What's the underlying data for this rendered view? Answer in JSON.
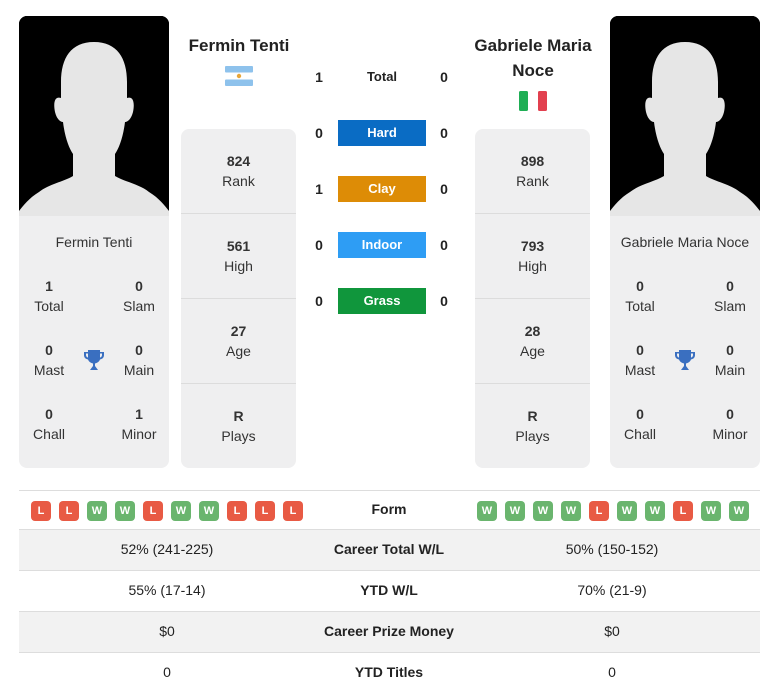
{
  "player1": {
    "name": "Fermin Tenti",
    "country_flag": "argentina-flag",
    "titles": {
      "total": {
        "value": "1",
        "label": "Total"
      },
      "slam": {
        "value": "0",
        "label": "Slam"
      },
      "mast": {
        "value": "0",
        "label": "Mast"
      },
      "main": {
        "value": "0",
        "label": "Main"
      },
      "chall": {
        "value": "0",
        "label": "Chall"
      },
      "minor": {
        "value": "1",
        "label": "Minor"
      }
    },
    "stats": [
      {
        "value": "824",
        "label": "Rank"
      },
      {
        "value": "561",
        "label": "High"
      },
      {
        "value": "27",
        "label": "Age"
      },
      {
        "value": "R",
        "label": "Plays"
      }
    ],
    "form": [
      "L",
      "L",
      "W",
      "W",
      "L",
      "W",
      "W",
      "L",
      "L",
      "L"
    ]
  },
  "player2": {
    "name": "Gabriele Maria Noce",
    "country_flag": "italy-flag",
    "titles": {
      "total": {
        "value": "0",
        "label": "Total"
      },
      "slam": {
        "value": "0",
        "label": "Slam"
      },
      "mast": {
        "value": "0",
        "label": "Mast"
      },
      "main": {
        "value": "0",
        "label": "Main"
      },
      "chall": {
        "value": "0",
        "label": "Chall"
      },
      "minor": {
        "value": "0",
        "label": "Minor"
      }
    },
    "stats": [
      {
        "value": "898",
        "label": "Rank"
      },
      {
        "value": "793",
        "label": "High"
      },
      {
        "value": "28",
        "label": "Age"
      },
      {
        "value": "R",
        "label": "Plays"
      }
    ],
    "form": [
      "W",
      "W",
      "W",
      "W",
      "L",
      "W",
      "W",
      "L",
      "W",
      "W"
    ]
  },
  "head_to_head": [
    {
      "label": "Total",
      "p1": "1",
      "p2": "0",
      "color": ""
    },
    {
      "label": "Hard",
      "p1": "0",
      "p2": "0",
      "color": "#0a6cc4"
    },
    {
      "label": "Clay",
      "p1": "1",
      "p2": "0",
      "color": "#dd8c06"
    },
    {
      "label": "Indoor",
      "p1": "0",
      "p2": "0",
      "color": "#2e9df4"
    },
    {
      "label": "Grass",
      "p1": "0",
      "p2": "0",
      "color": "#10963c"
    }
  ],
  "comparison": {
    "form_label": "Form",
    "rows": [
      {
        "label": "Career Total W/L",
        "p1": "52% (241-225)",
        "p2": "50% (150-152)"
      },
      {
        "label": "YTD W/L",
        "p1": "55% (17-14)",
        "p2": "70% (21-9)"
      },
      {
        "label": "Career Prize Money",
        "p1": "$0",
        "p2": "$0"
      },
      {
        "label": "YTD Titles",
        "p1": "0",
        "p2": "0"
      }
    ]
  },
  "colors": {
    "win": "#6ab56e",
    "loss": "#e85a44",
    "trophy": "#3a6fc0"
  }
}
